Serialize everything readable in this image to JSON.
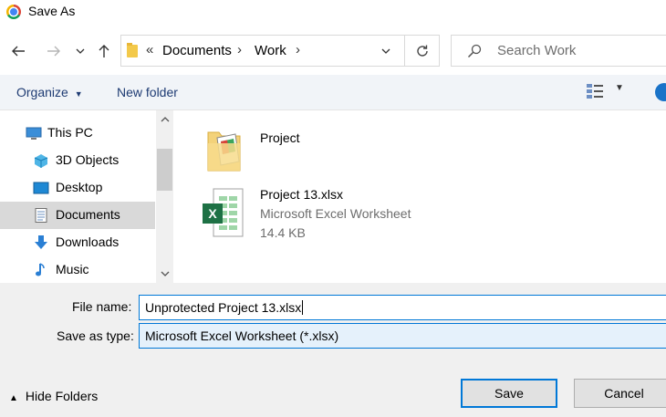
{
  "window": {
    "title": "Save As"
  },
  "address": {
    "overflow": "«",
    "crumbs": [
      "Documents",
      "Work"
    ],
    "separator": "›"
  },
  "search": {
    "placeholder": "Search Work"
  },
  "toolbar": {
    "organize_label": "Organize",
    "new_folder_label": "New folder"
  },
  "nav": {
    "items": [
      {
        "label": "This PC",
        "icon": "computer-icon"
      },
      {
        "label": "3D Objects",
        "icon": "cube-icon"
      },
      {
        "label": "Desktop",
        "icon": "desktop-icon"
      },
      {
        "label": "Documents",
        "icon": "document-icon",
        "selected": true
      },
      {
        "label": "Downloads",
        "icon": "download-arrow-icon"
      },
      {
        "label": "Music",
        "icon": "music-note-icon"
      }
    ]
  },
  "files": [
    {
      "name": "Project",
      "icon": "folder-icon"
    },
    {
      "name": "Project 13.xlsx",
      "type": "Microsoft Excel Worksheet",
      "size": "14.4 KB",
      "icon": "excel-file-icon"
    }
  ],
  "form": {
    "file_name_label": "File name:",
    "file_name_value": "Unprotected Project 13.xlsx",
    "save_type_label": "Save as type:",
    "save_type_value": "Microsoft Excel Worksheet (*.xlsx)"
  },
  "footer": {
    "hide_folders_label": "Hide Folders",
    "save_label": "Save",
    "cancel_label": "Cancel"
  },
  "colors": {
    "accent": "#0078d7",
    "toolbar_bg": "#f1f4f8",
    "selected_bg": "#d9d9d9",
    "link_text": "#1e3b73"
  }
}
